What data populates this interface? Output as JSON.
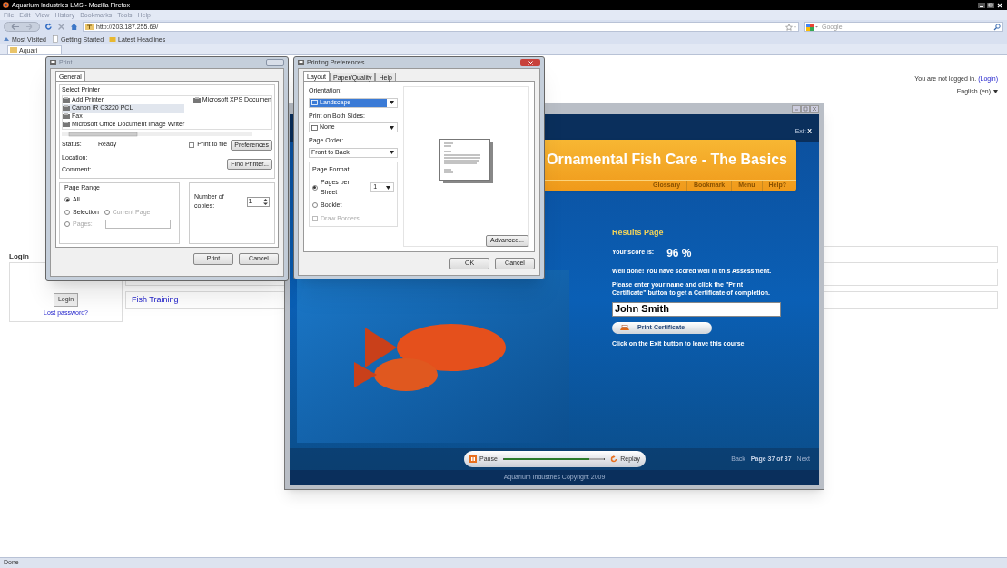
{
  "browser": {
    "title": "Aquarium Industries LMS - Mozilla Firefox",
    "menu": [
      "File",
      "Edit",
      "View",
      "History",
      "Bookmarks",
      "Tools",
      "Help"
    ],
    "url": "http://203.187.255.69/",
    "search_placeholder": "Google",
    "bookmarks": [
      "Most Visited",
      "Getting Started",
      "Latest Headlines"
    ],
    "tab": "Aquari",
    "status": "Done"
  },
  "page": {
    "login_status": "You are not logged in.",
    "login_link": "(Login)",
    "language": "English (en)",
    "login_title": "Login",
    "login_button": "Login",
    "lost_password": "Lost password?",
    "course_link": "Fish Training"
  },
  "course": {
    "exit": "Exit",
    "exit_mark": "X",
    "title": "Ornamental Fish Care - The Basics",
    "nav": [
      "Glossary",
      "Bookmark",
      "Menu",
      "Help?"
    ],
    "results_title": "Results Page",
    "score_label": "Your score is:",
    "score": "96 %",
    "messages": [
      "Well done! You have scored well in this Assessment.",
      "Please enter your name and click the \"Print Certificate\" button to get a Certificate of completion."
    ],
    "name_value": "John Smith",
    "print_button": "Print Certificate",
    "exit_note": "Click on the Exit button to leave this course.",
    "pause": "Pause",
    "volume": {
      "level": 0.85
    },
    "replay": "Replay",
    "back": "Back",
    "page_count": "Page 37 of 37",
    "next": "Next",
    "copyright": "Aquarium Industries Copyright 2009"
  },
  "print_dialog": {
    "title": "Print",
    "tabs": [
      {
        "label": "General",
        "selected": true
      }
    ],
    "select_printer": "Select Printer",
    "printers": [
      {
        "name": "Add Printer",
        "selected": false
      },
      {
        "name": "Canon iR C3220 PCL",
        "selected": true
      },
      {
        "name": "Fax",
        "selected": false
      },
      {
        "name": "Microsoft Office Document Image Writer",
        "selected": false
      },
      {
        "name": "Microsoft XPS Documen",
        "selected": false
      }
    ],
    "status_label": "Status:",
    "status": "Ready",
    "location_label": "Location:",
    "comment_label": "Comment:",
    "print_to_file": {
      "label": "Print to file",
      "checked": false
    },
    "preferences": "Preferences",
    "find_printer": "Find Printer...",
    "page_range": "Page Range",
    "range_options": [
      {
        "label": "All",
        "selected": true,
        "disabled": false
      },
      {
        "label": "Selection",
        "selected": false,
        "disabled": false
      },
      {
        "label": "Current Page",
        "selected": false,
        "disabled": true
      },
      {
        "label": "Pages:",
        "selected": false,
        "disabled": true
      }
    ],
    "copies_label": "Number of copies:",
    "copies": "1",
    "buttons": [
      "Print",
      "Cancel"
    ]
  },
  "preferences_dialog": {
    "title": "Printing Preferences",
    "tabs": [
      {
        "label": "Layout",
        "selected": true
      },
      {
        "label": "Paper/Quality",
        "selected": false
      },
      {
        "label": "Help",
        "selected": false
      }
    ],
    "orientation_label": "Orientation:",
    "orientation": "Landscape",
    "both_sides_label": "Print on Both Sides:",
    "both_sides": "None",
    "page_order_label": "Page Order:",
    "page_order": "Front to Back",
    "page_format": "Page Format",
    "format_options": [
      {
        "label": "Pages per Sheet",
        "selected": true
      },
      {
        "label": "Booklet",
        "selected": false
      }
    ],
    "pages_per_sheet": "1",
    "draw_borders": {
      "label": "Draw Borders",
      "checked": false,
      "disabled": true
    },
    "advanced": "Advanced...",
    "buttons": [
      "OK",
      "Cancel"
    ]
  }
}
